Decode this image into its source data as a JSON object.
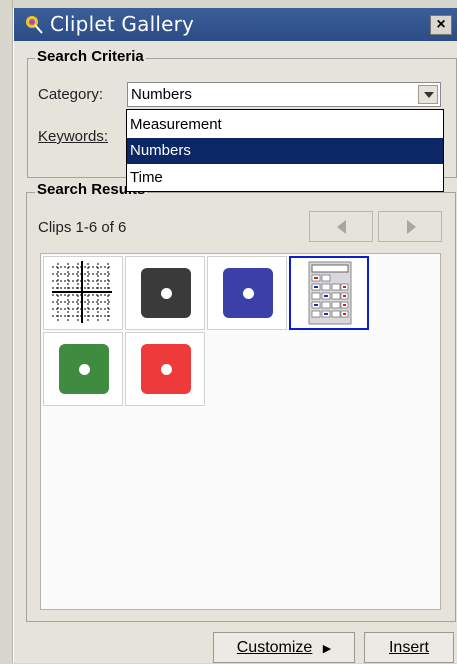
{
  "window": {
    "title": "Cliplet Gallery",
    "close_label": "×"
  },
  "criteria": {
    "group_label": "Search Criteria",
    "category_label": "Category:",
    "category_value": "Numbers",
    "keywords_label": "Keywords:",
    "options": [
      "Measurement",
      "Numbers",
      "Time"
    ],
    "selected_option": "Numbers"
  },
  "results": {
    "group_label": "Search Results",
    "count_text": "Clips 1-6 of 6",
    "tiles": [
      {
        "name": "grid-chart-cliplet"
      },
      {
        "name": "black-die-cliplet",
        "color": "#3a3a3a"
      },
      {
        "name": "blue-die-cliplet",
        "color": "#3b3fa8"
      },
      {
        "name": "calculator-cliplet",
        "selected": true
      },
      {
        "name": "green-die-cliplet",
        "color": "#3f8b3f"
      },
      {
        "name": "red-die-cliplet",
        "color": "#ee3a3a"
      }
    ]
  },
  "buttons": {
    "customize_label": "Customize",
    "insert_label": "Insert"
  }
}
